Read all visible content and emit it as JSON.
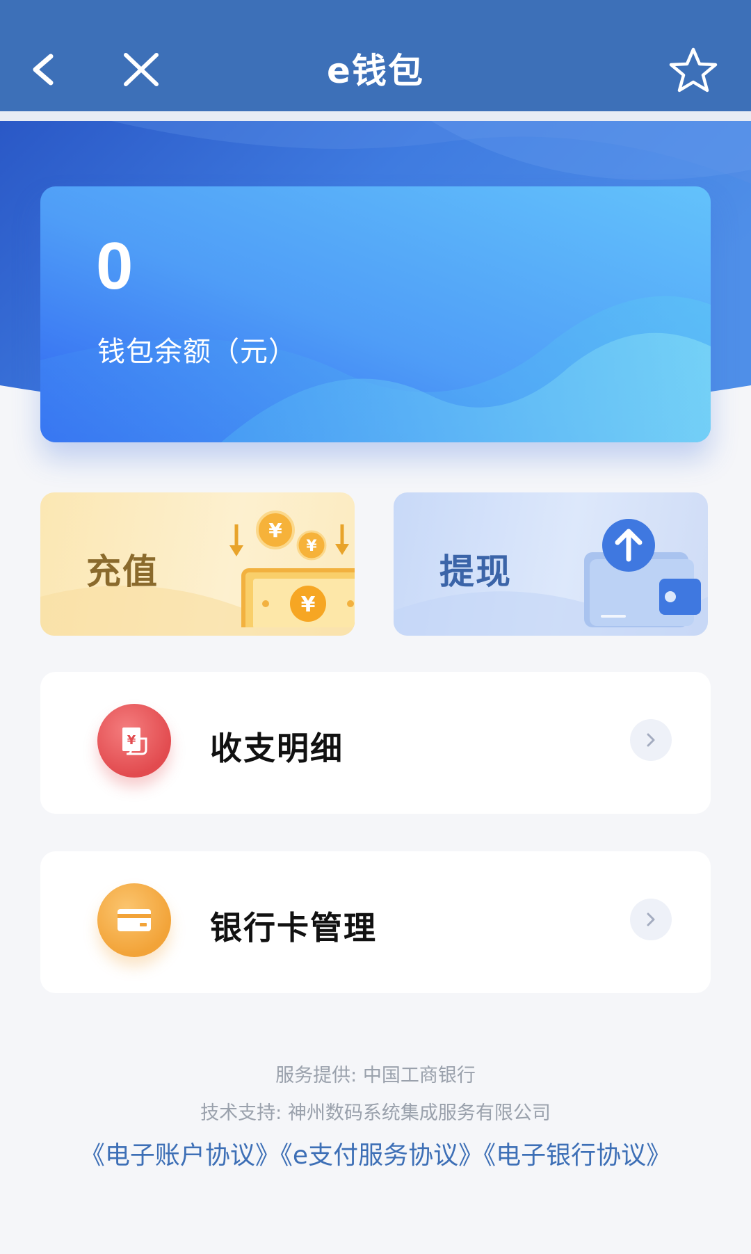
{
  "navbar": {
    "title": "e钱包",
    "back_icon": "chevron-left-icon",
    "close_icon": "close-icon",
    "favorite_icon": "star-outline-icon"
  },
  "balance": {
    "amount": "0",
    "label": "钱包余额（元）"
  },
  "actions": {
    "recharge_label": "充值",
    "withdraw_label": "提现"
  },
  "menu": [
    {
      "label": "收支明细",
      "icon": "receipt-icon",
      "icon_color": "#e24b4f"
    },
    {
      "label": "银行卡管理",
      "icon": "bank-card-icon",
      "icon_color": "#f2a338"
    }
  ],
  "footer": {
    "provider": "服务提供: 中国工商银行",
    "support": "技术支持: 神州数码系统集成服务有限公司",
    "links": [
      "《电子账户协议》",
      "《e支付服务协议》",
      "《电子银行协议》"
    ]
  },
  "colors": {
    "navbar": "#3d70b8",
    "link": "#3d6fb6",
    "background": "#f5f6f9"
  }
}
